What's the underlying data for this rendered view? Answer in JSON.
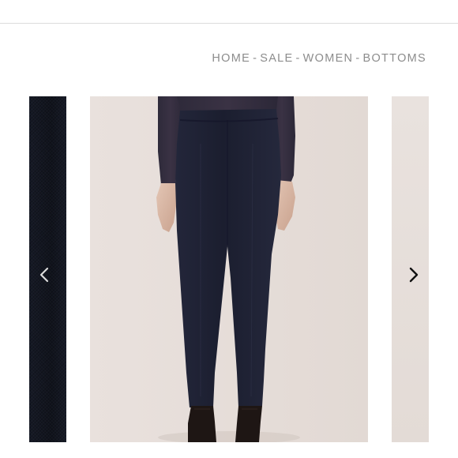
{
  "breadcrumb": {
    "items": [
      "HOME",
      "SALE",
      "WOMEN",
      "BOTTOMS"
    ],
    "separator": "-"
  },
  "carousel": {
    "prev_arrow_icon": "chevron-left-icon",
    "next_arrow_icon": "chevron-right-icon",
    "main_image": "high-waisted navy skinny trousers with black ankle boots on model",
    "prev_image": "navy fabric close-up",
    "next_image": "product image partially visible"
  },
  "colors": {
    "breadcrumb_text": "#8c8c8c",
    "trouser_navy": "#1c1f30",
    "backdrop": "#e6ded9"
  }
}
